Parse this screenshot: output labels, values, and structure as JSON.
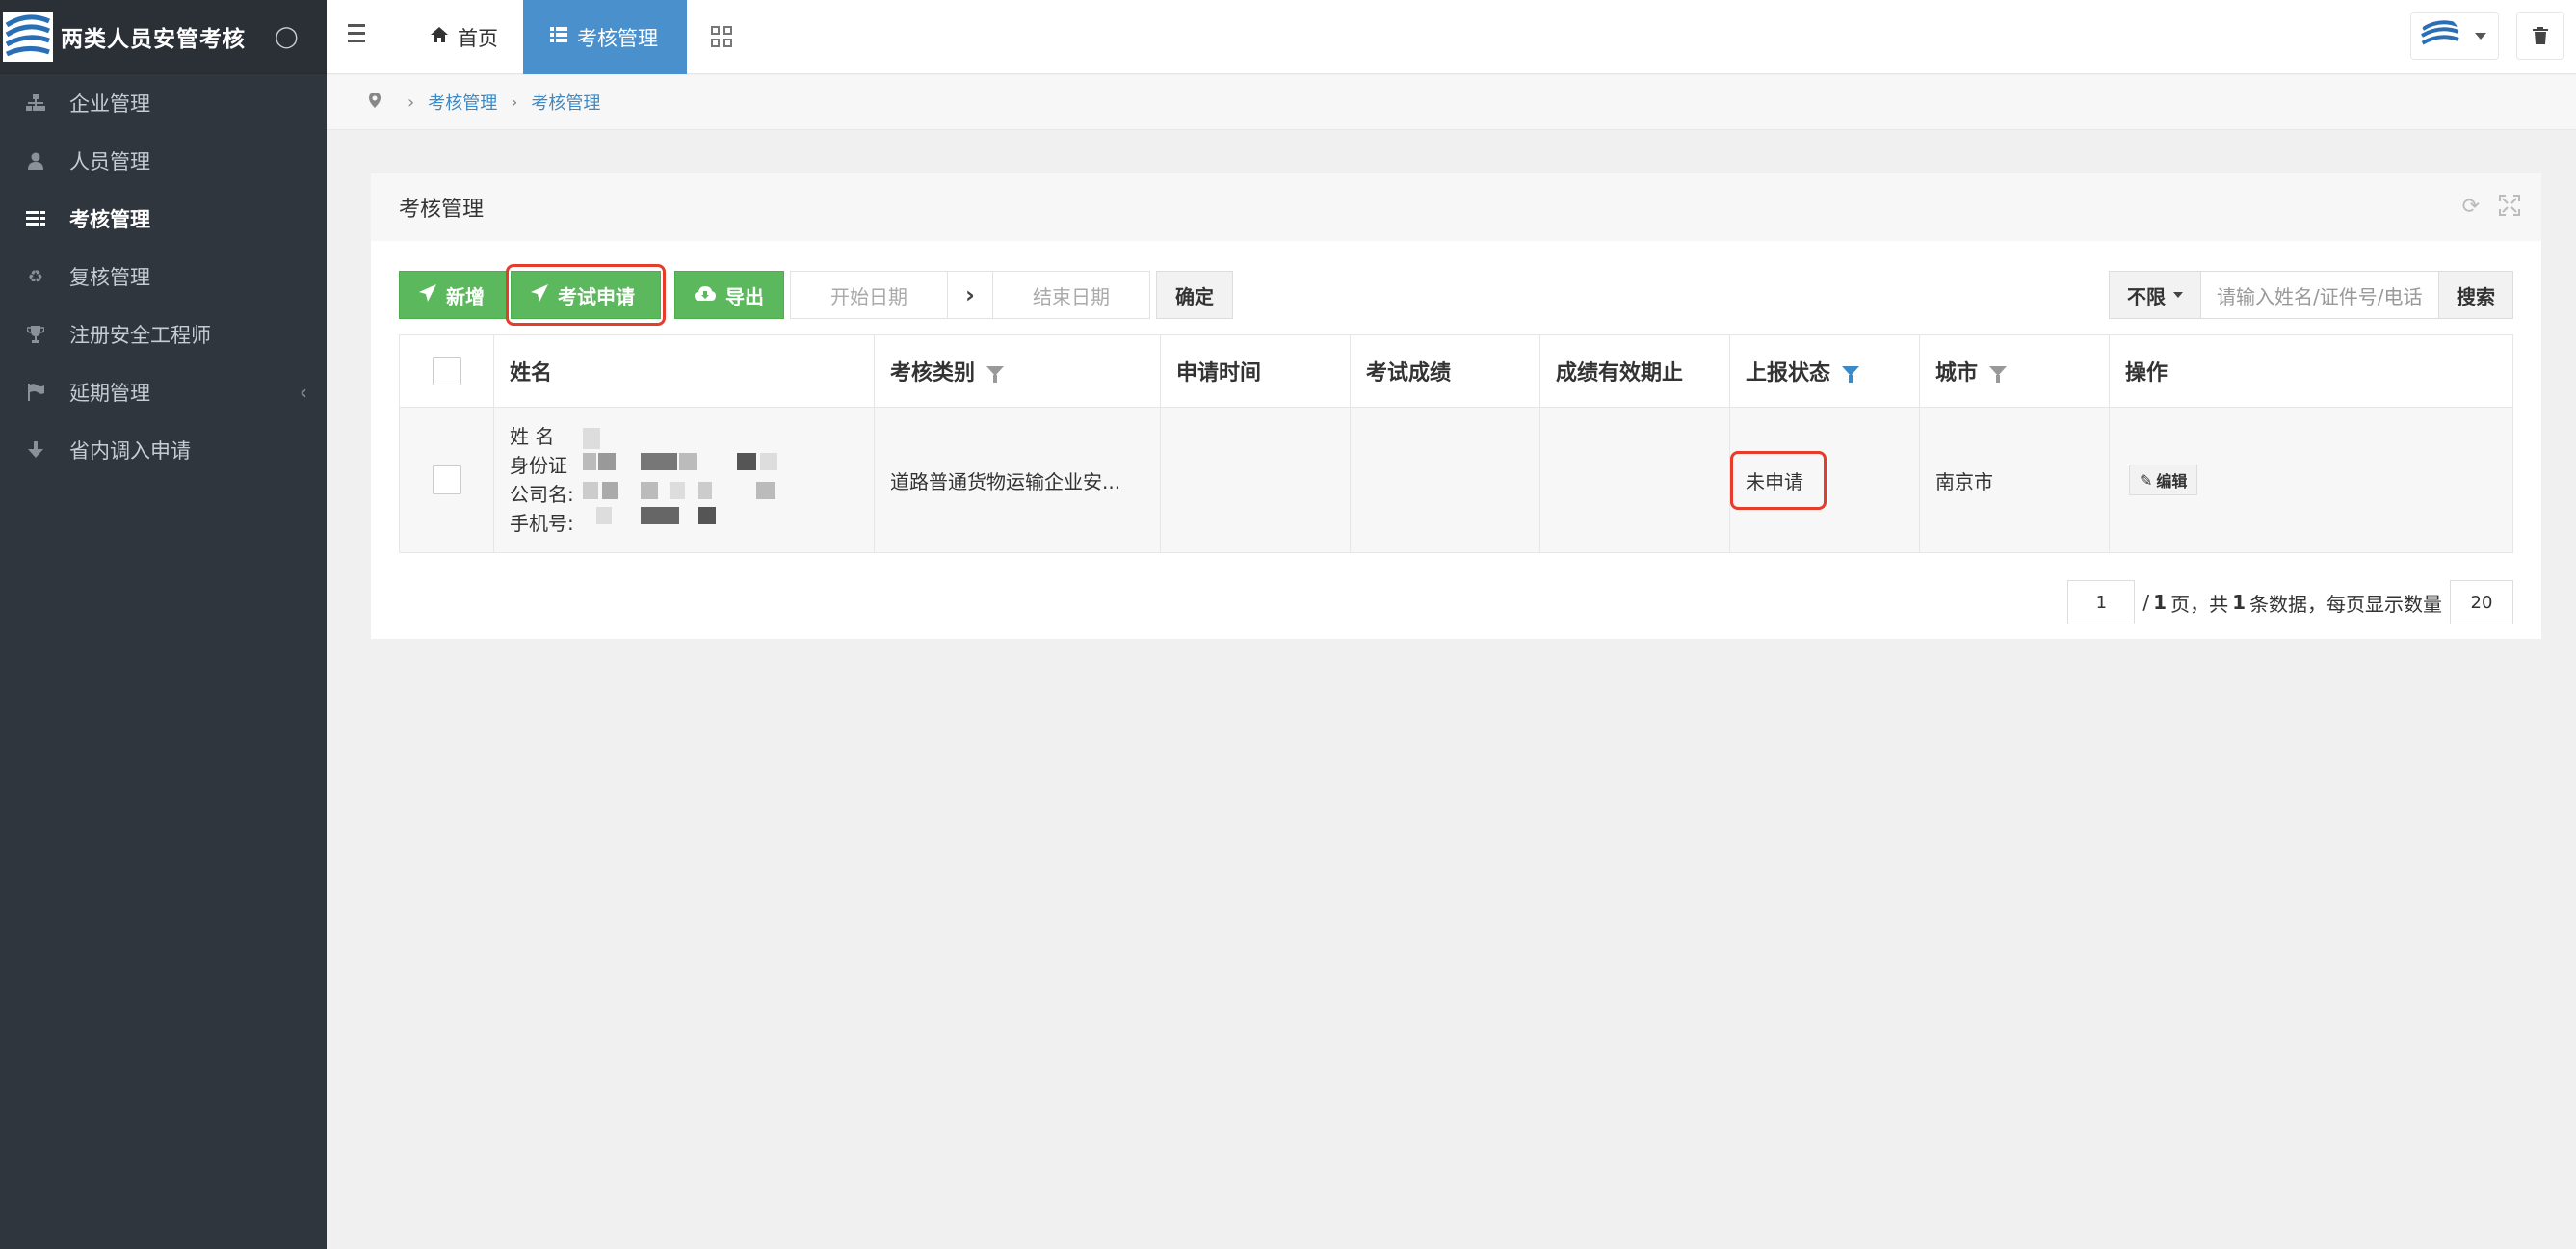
{
  "brand": {
    "title": "两类人员安管考核"
  },
  "sidebar": {
    "items": [
      {
        "label": "企业管理",
        "icon": "sitemap-icon"
      },
      {
        "label": "人员管理",
        "icon": "user-icon"
      },
      {
        "label": "考核管理",
        "icon": "list-icon",
        "active": true
      },
      {
        "label": "复核管理",
        "icon": "recycle-icon"
      },
      {
        "label": "注册安全工程师",
        "icon": "trophy-icon"
      },
      {
        "label": "延期管理",
        "icon": "flag-icon",
        "has_children": true
      },
      {
        "label": "省内调入申请",
        "icon": "download-icon"
      }
    ]
  },
  "topbar": {
    "tabs": [
      {
        "label": "首页",
        "icon": "home-icon"
      },
      {
        "label": "考核管理",
        "icon": "list-icon",
        "active": true
      }
    ]
  },
  "breadcrumb": {
    "items": [
      "考核管理",
      "考核管理"
    ]
  },
  "panel": {
    "title": "考核管理"
  },
  "toolbar": {
    "add_label": "新增",
    "apply_label": "考试申请",
    "export_label": "导出",
    "start_date_placeholder": "开始日期",
    "end_date_placeholder": "结束日期",
    "confirm_label": "确定"
  },
  "search": {
    "filter_value": "不限",
    "placeholder": "请输入姓名/证件号/电话",
    "button_label": "搜索"
  },
  "table": {
    "headers": [
      "姓名",
      "考核类别",
      "申请时间",
      "考试成绩",
      "成绩有效期止",
      "上报状态",
      "城市",
      "操作"
    ],
    "rows": [
      {
        "name_label": "姓 名",
        "id_label": "身份证",
        "company_label": "公司名:",
        "phone_label": "手机号:",
        "category": "道路普通货物运输企业安...",
        "apply_time": "",
        "score": "",
        "valid_until": "",
        "status": "未申请",
        "city": "南京市",
        "edit_label": "编辑"
      }
    ]
  },
  "pager": {
    "current_page": "1",
    "text_before_total": "/",
    "total_pages": "1",
    "text_pages": "页，共",
    "total_records": "1",
    "text_records": "条数据，每页显示数量",
    "page_size": "20"
  },
  "colors": {
    "accent": "#4a90cc",
    "success": "#5cb85c",
    "sidebar": "#2f363d",
    "highlight": "#e53c2c"
  }
}
